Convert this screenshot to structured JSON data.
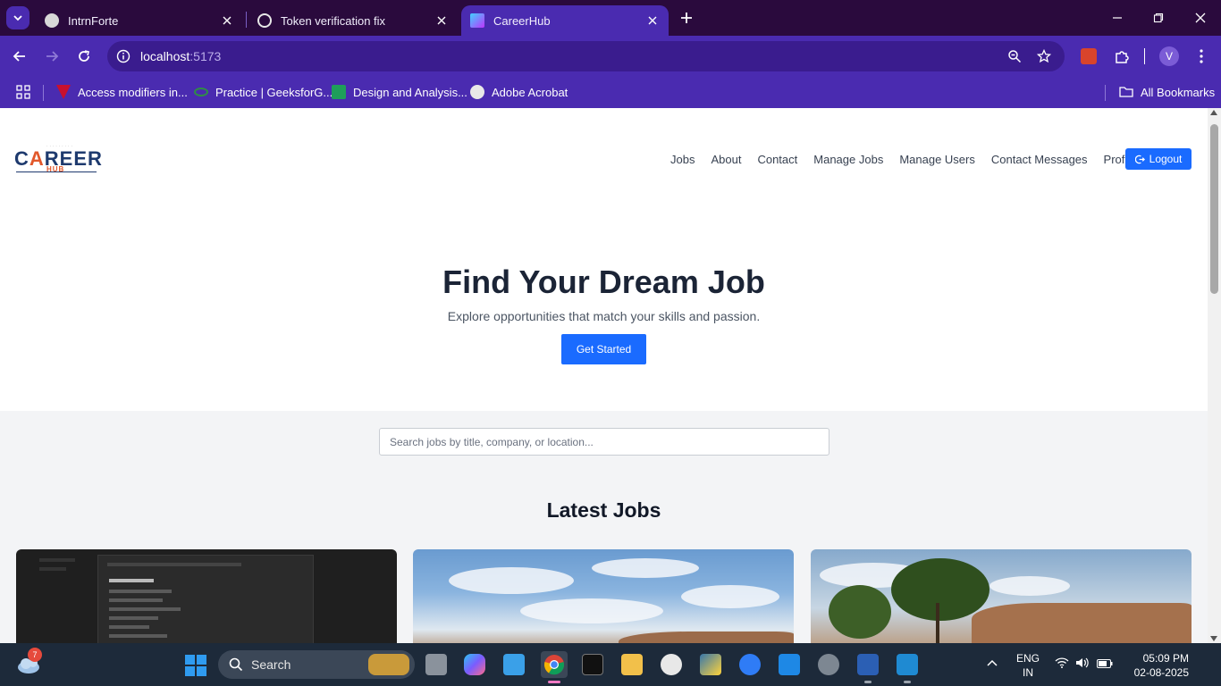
{
  "browser": {
    "tabs": [
      {
        "title": "IntrnForte",
        "active": false
      },
      {
        "title": "Token verification fix",
        "active": false
      },
      {
        "title": "CareerHub",
        "active": true
      }
    ],
    "address": {
      "host": "localhost",
      "port": ":5173"
    },
    "profile_initial": "V",
    "bookmarks": [
      {
        "label": "Access modifiers in..."
      },
      {
        "label": "Practice | GeeksforG..."
      },
      {
        "label": "Design and Analysis..."
      },
      {
        "label": "Adobe Acrobat"
      }
    ],
    "all_bookmarks": "All Bookmarks"
  },
  "site": {
    "logo": {
      "prefix": "C",
      "accent": "A",
      "rest": "REER",
      "sub": "HUB"
    },
    "nav": [
      {
        "label": "Jobs"
      },
      {
        "label": "About"
      },
      {
        "label": "Contact"
      },
      {
        "label": "Manage Jobs"
      },
      {
        "label": "Manage Users"
      },
      {
        "label": "Contact Messages"
      },
      {
        "label": "Profile"
      }
    ],
    "logout_label": "Logout",
    "hero": {
      "title": "Find Your Dream Job",
      "subtitle": "Explore opportunities that match your skills and passion.",
      "cta": "Get Started"
    },
    "search": {
      "placeholder": "Search jobs by title, company, or location...",
      "value": ""
    },
    "latest_title": "Latest Jobs",
    "job_cards": [
      {
        "image": "app-settings-screenshot"
      },
      {
        "image": "sky-landscape-photo"
      },
      {
        "image": "trees-cliff-photo"
      }
    ]
  },
  "taskbar": {
    "weather_badge": "7",
    "search_label": "Search",
    "lang_top": "ENG",
    "lang_bottom": "IN",
    "time": "05:09 PM",
    "date": "02-08-2025"
  },
  "colors": {
    "brand": "#1a6bff",
    "chrome": "#4a2bb0",
    "tabstrip": "#2a0a3d"
  }
}
